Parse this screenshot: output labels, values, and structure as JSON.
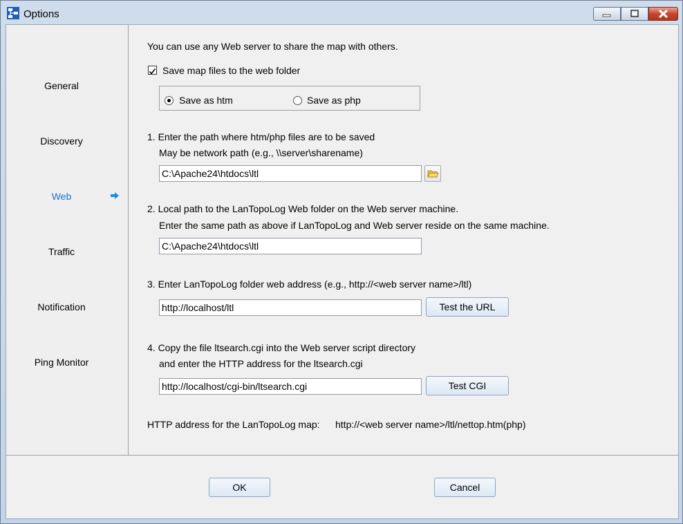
{
  "window": {
    "title": "Options"
  },
  "sidebar": {
    "items": [
      {
        "label": "General"
      },
      {
        "label": "Discovery"
      },
      {
        "label": "Web"
      },
      {
        "label": "Traffic"
      },
      {
        "label": "Notification"
      },
      {
        "label": "Ping Monitor"
      }
    ],
    "active": "Web"
  },
  "web": {
    "intro": "You can use any Web server to share the map with others.",
    "save_checkbox_label": "Save map files to the web folder",
    "save_checkbox_checked": true,
    "radio_htm_label": "Save as htm",
    "radio_php_label": "Save as php",
    "radio_selected": "htm",
    "step1_line1": "1. Enter the path where htm/php files are to be saved",
    "step1_line2": "May be network path (e.g., \\\\server\\sharename)",
    "step1_value": "C:\\Apache24\\htdocs\\ltl",
    "step2_line1": "2. Local path to the LanTopoLog Web folder on the Web server machine.",
    "step2_line2": "Enter the same path as above if LanTopoLog and Web server reside on the same machine.",
    "step2_value": "C:\\Apache24\\htdocs\\ltl",
    "step3_line1": "3. Enter LanTopoLog folder web address (e.g., http://<web server name>/ltl)",
    "step3_value": "http://localhost/ltl",
    "test_url_label": "Test the URL",
    "step4_line1": "4. Copy the file ltsearch.cgi into the Web server script directory",
    "step4_line2": "and enter the HTTP address for the ltsearch.cgi",
    "step4_value": "http://localhost/cgi-bin/ltsearch.cgi",
    "test_cgi_label": "Test CGI",
    "http_label": "HTTP address for the LanTopoLog map:",
    "http_value": "http://<web server name>/ltl/nettop.htm(php)"
  },
  "footer": {
    "ok_label": "OK",
    "cancel_label": "Cancel"
  },
  "colors": {
    "accent": "#1a6fc9",
    "close": "#c7452c"
  },
  "icons": [
    "app-icon",
    "minimize-icon",
    "maximize-icon",
    "close-icon",
    "arrow-right-icon",
    "folder-icon"
  ]
}
